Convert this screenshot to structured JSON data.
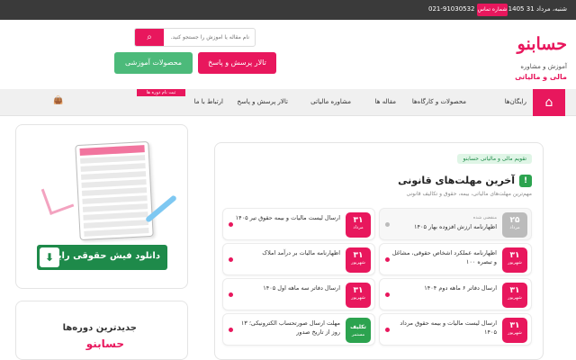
{
  "topbar": {
    "date": "شنبه، مرداد 31 1405",
    "phone_label": "شماره تماس",
    "phone_number": "021-91030532"
  },
  "logo": {
    "brand": "حسابنو",
    "tagline1": "آموزش و مشاوره",
    "tagline2": "مالی و مالیاتی"
  },
  "search": {
    "placeholder": "نام مقاله یا آموزش را جستجو کنید.",
    "icon": "search-icon"
  },
  "header_buttons": {
    "forum": "تالار پرسش و پاسخ",
    "products": "محصولات آموزشی"
  },
  "nav": {
    "home_icon": "home-icon",
    "items": [
      "رایگان‌ها",
      "محصولات و کارگاه‌ها",
      "مقاله ها",
      "مشاوره مالیاتی",
      "تالار پرسش و پاسخ",
      "ارتباط با ما"
    ],
    "banner": "ثبت نام دوره ها",
    "cart_icon": "cart-icon"
  },
  "sidebar": {
    "download_banner": "دانلود فیش حقوقی رایگان",
    "download_icon": "download-icon",
    "courses_title1": "جدیدترین دوره‌ها",
    "courses_title2": "حسابنو"
  },
  "main": {
    "tag": "تقویم مالی و مالیاتی حسابنو",
    "heading": "آخرین مهلت‌های قانونی",
    "heading_icon": "!",
    "subheading": "مهم‌ترین مهلت‌های مالیاتی، بیمه، حقوق و تکالیف قانونی",
    "deadlines": [
      {
        "day": "۲۵",
        "month": "مرداد",
        "badge": "منقضی شده",
        "text": "اظهارنامه ارزش افزوده بهار ۱۴۰۵",
        "status": "expired"
      },
      {
        "day": "۳۱",
        "month": "مرداد",
        "badge": "",
        "text": "ارسال لیست مالیات و بیمه حقوق تیر ۱۴۰۵",
        "status": "active"
      },
      {
        "day": "۳۱",
        "month": "شهریور",
        "badge": "",
        "text": "اظهارنامه عملکرد اشخاص حقوقی، مشاغل و تبصره ۱۰۰",
        "status": "active"
      },
      {
        "day": "۳۱",
        "month": "شهریور",
        "badge": "",
        "text": "اظهارنامه مالیات بر درآمد املاک",
        "status": "active"
      },
      {
        "day": "۳۱",
        "month": "شهریور",
        "badge": "",
        "text": "ارسال دفاتر ۶ ماهه دوم ۱۴۰۴",
        "status": "active"
      },
      {
        "day": "۳۱",
        "month": "شهریور",
        "badge": "",
        "text": "ارسال دفاتر سه ماهه اول ۱۴۰۵",
        "status": "active"
      },
      {
        "day": "۳۱",
        "month": "شهریور",
        "badge": "",
        "text": "ارسال لیست مالیات و بیمه حقوق مرداد ۱۴۰۵",
        "status": "active"
      },
      {
        "day": "تکلیف",
        "month": "مستمر",
        "badge": "",
        "text": "مهلت ارسال صورتحساب الکترونیکی؛ ۱۳ روز از تاریخ صدور",
        "status": "continuous"
      }
    ]
  }
}
